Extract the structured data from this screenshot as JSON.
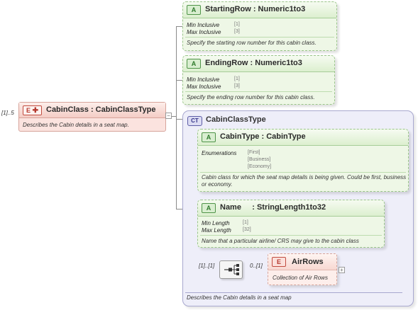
{
  "element": {
    "tag": "E",
    "title": "CabinClass : CabinClassType",
    "occurrence": "[1]..5",
    "doc": "Describes the Cabin details in a seat map."
  },
  "attributes": [
    {
      "tag": "A",
      "title": "StartingRow : Numeric1to3",
      "facets": [
        {
          "label": "Min Inclusive",
          "value": "[1]"
        },
        {
          "label": "Max Inclusive",
          "value": "[3]"
        }
      ],
      "doc": "Specify the starting row number for this cabin class."
    },
    {
      "tag": "A",
      "title": "EndingRow : Numeric1to3",
      "facets": [
        {
          "label": "Min Inclusive",
          "value": "[1]"
        },
        {
          "label": "Max Inclusive",
          "value": "[3]"
        }
      ],
      "doc": "Specify the ending row number for this cabin class."
    }
  ],
  "complex_type": {
    "tag": "CT",
    "title": "CabinClassType",
    "doc": "Describes the Cabin details in a seat map",
    "cabin_type": {
      "tag": "A",
      "title": "CabinType : CabinType",
      "enum_label": "Enumerations",
      "enums": [
        "[First]",
        "[Business]",
        "[Economy]"
      ],
      "doc": "Cabin class for which the seat map details is being given. Could be first, business or economy."
    },
    "name_attr": {
      "tag": "A",
      "title": "Name     : StringLength1to32",
      "facets": [
        {
          "label": "Min Length",
          "value": "[1]"
        },
        {
          "label": "Max Length",
          "value": "[32]"
        }
      ],
      "doc": "Name that a particular airline/ CRS may give to the  cabin class"
    },
    "sequence_occurrence": "[1]..[1]",
    "airrows": {
      "tag": "E",
      "title": "AirRows",
      "occurrence": "0..[1]",
      "doc": "Collection of Air Rows"
    }
  },
  "colors": {
    "element_fill": "#fbe3df",
    "attribute_fill": "#eef7e6",
    "complex_type_fill": "#eeeef9"
  }
}
